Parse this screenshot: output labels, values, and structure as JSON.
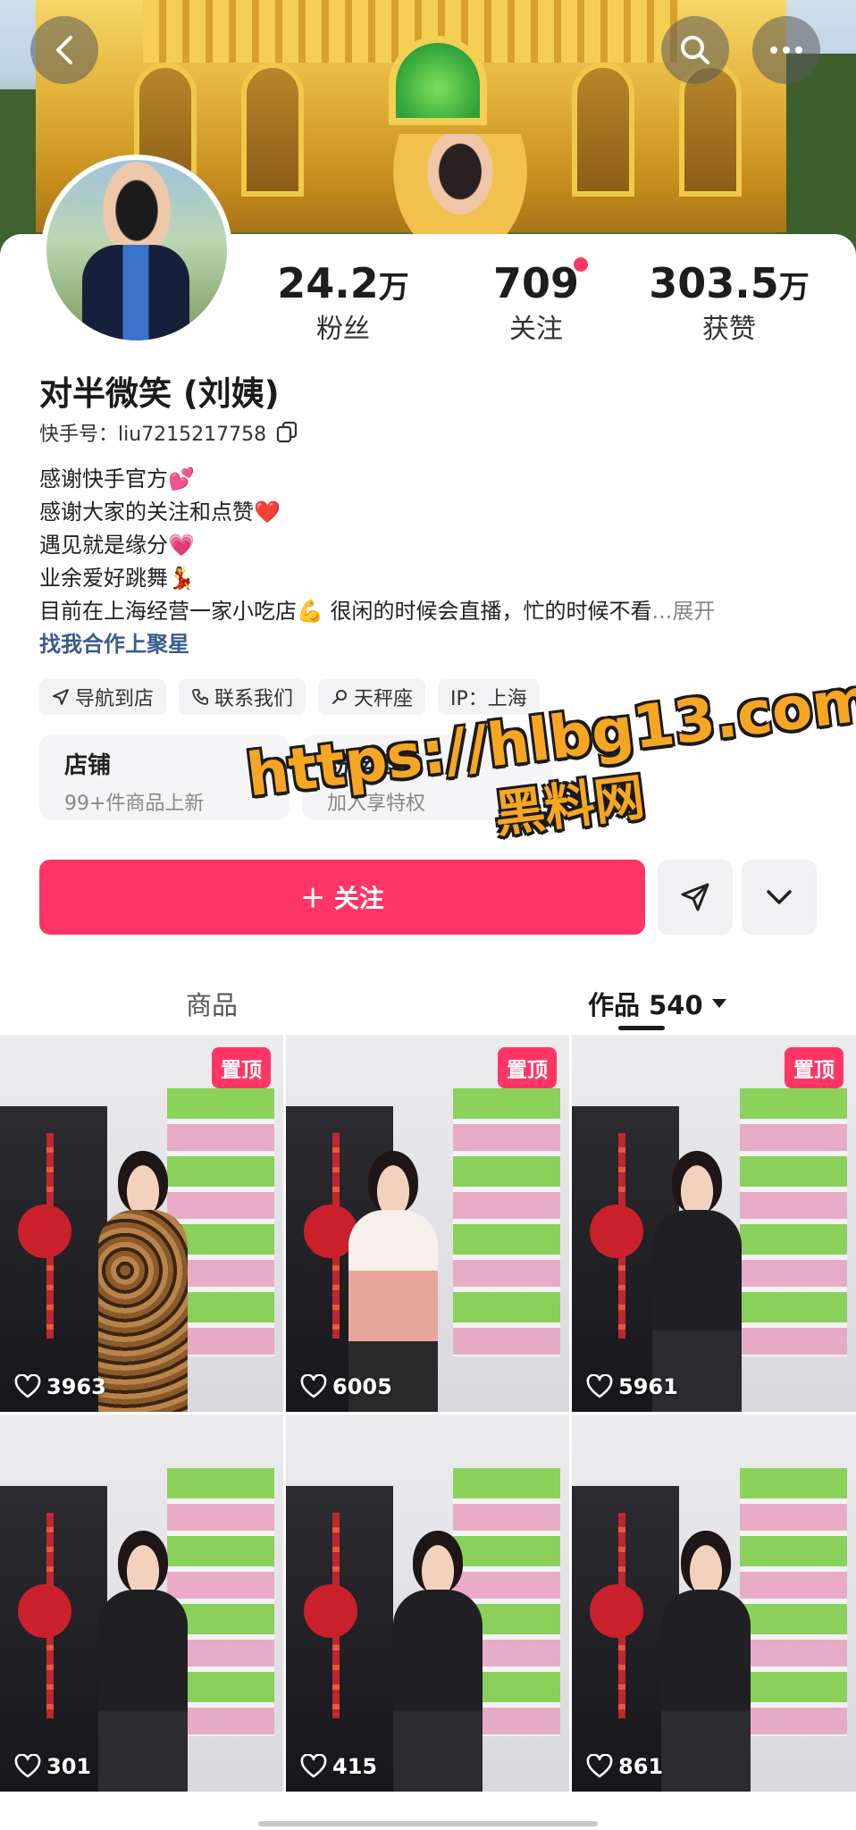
{
  "profile": {
    "name": "对半微笑 (刘姨)",
    "uid_label": "快手号：",
    "uid": "liu7215217758",
    "stats": [
      {
        "value": "24.2",
        "unit": "万",
        "label": "粉丝"
      },
      {
        "value": "709",
        "unit": "",
        "label": "关注"
      },
      {
        "value": "303.5",
        "unit": "万",
        "label": "获赞"
      }
    ],
    "bio": [
      "感谢快手官方💕",
      "感谢大家的关注和点赞❤️",
      "遇见就是缘分💗",
      "业余爱好跳舞💃",
      "目前在上海经营一家小吃店💪 很闲的时候会直播，忙的时候不看"
    ],
    "bio_more": "...展开",
    "bio_link": "找我合作上聚星"
  },
  "tags": [
    {
      "icon": "navigation-icon",
      "label": "导航到店"
    },
    {
      "icon": "phone-icon",
      "label": "联系我们"
    },
    {
      "icon": "search-icon",
      "label": "天秤座"
    },
    {
      "icon": "",
      "label": "IP：上海"
    }
  ],
  "cards": [
    {
      "title": "店铺",
      "subtitle": "99+件商品上新"
    },
    {
      "title": "粉丝团",
      "subtitle": "加入享特权"
    }
  ],
  "actions": {
    "follow_label": "＋ 关注"
  },
  "watermark": {
    "line1": "https://hlbg13.com",
    "line2": "黑料网"
  },
  "tabs": [
    {
      "label": "商品",
      "active": false
    },
    {
      "label": "作品 540",
      "active": true
    }
  ],
  "videos": [
    {
      "pinned": true,
      "pin_label": "置顶",
      "likes": "3963",
      "outfit": "leopard"
    },
    {
      "pinned": true,
      "pin_label": "置顶",
      "likes": "6005",
      "outfit": "pink"
    },
    {
      "pinned": true,
      "pin_label": "置顶",
      "likes": "5961",
      "outfit": "black"
    },
    {
      "pinned": false,
      "pin_label": "",
      "likes": "301",
      "outfit": "black"
    },
    {
      "pinned": false,
      "pin_label": "",
      "likes": "415",
      "outfit": "black"
    },
    {
      "pinned": false,
      "pin_label": "",
      "likes": "861",
      "outfit": "black"
    }
  ],
  "colors": {
    "accent": "#fe3666",
    "link": "#3b5b8c",
    "watermark": "#f6a623"
  }
}
